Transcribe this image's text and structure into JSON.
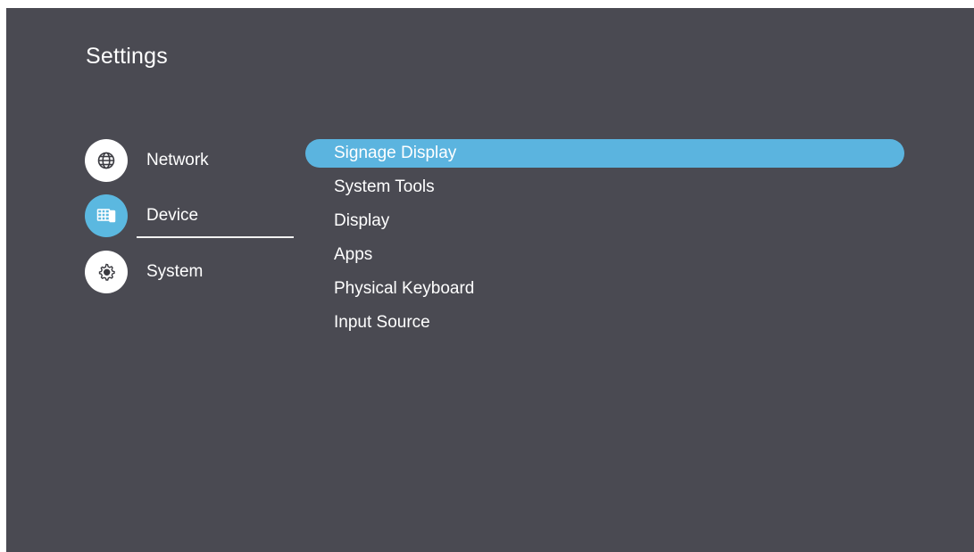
{
  "title": "Settings",
  "categories": [
    {
      "label": "Network",
      "icon": "globe-icon",
      "active": false
    },
    {
      "label": "Device",
      "icon": "device-icon",
      "active": true
    },
    {
      "label": "System",
      "icon": "gear-icon",
      "active": false
    }
  ],
  "submenu": [
    {
      "label": "Signage Display",
      "selected": true
    },
    {
      "label": "System Tools",
      "selected": false
    },
    {
      "label": "Display",
      "selected": false
    },
    {
      "label": "Apps",
      "selected": false
    },
    {
      "label": "Physical Keyboard",
      "selected": false
    },
    {
      "label": "Input Source",
      "selected": false
    }
  ],
  "colors": {
    "background": "#4a4a52",
    "accent": "#5bb4df",
    "text": "#ffffff"
  }
}
